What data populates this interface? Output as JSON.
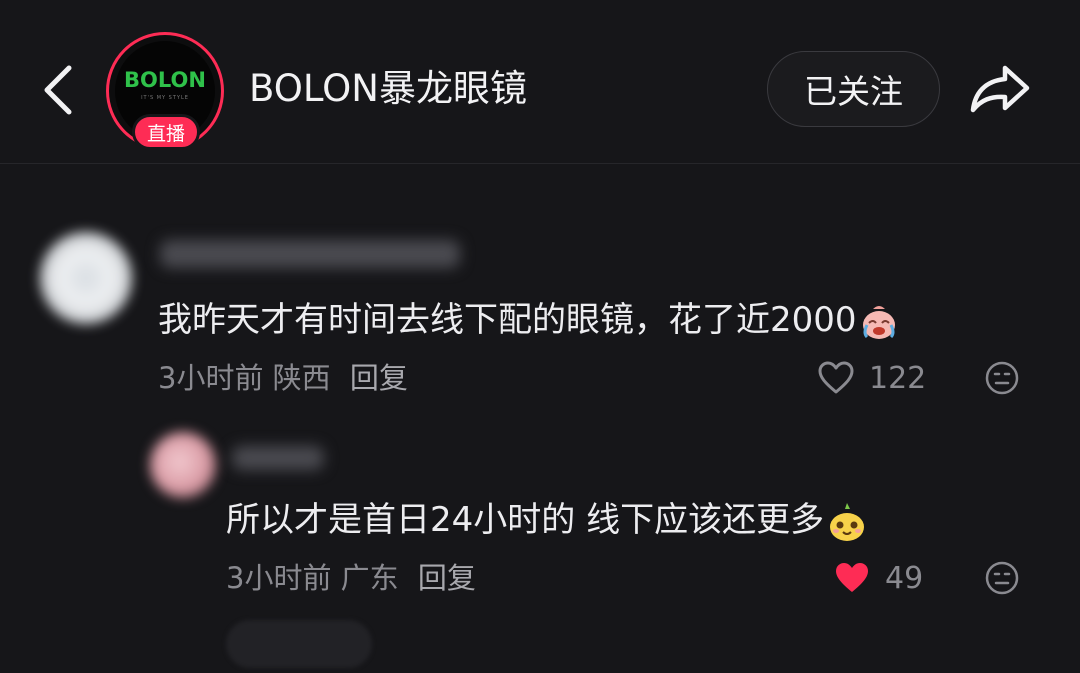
{
  "header": {
    "account_name": "BOLON暴龙眼镜",
    "avatar_logo": "BOLON",
    "avatar_tagline": "IT'S MY STYLE",
    "live_badge": "直播",
    "follow_label": "已关注",
    "back_icon": "chevron-left-icon",
    "share_icon": "share-arrow-icon"
  },
  "comments": [
    {
      "text": "我昨天才有时间去线下配的眼镜，花了近2000",
      "emoji": "crying-emoji",
      "time": "3小时前",
      "location": "陕西",
      "reply_label": "回复",
      "likes": "122",
      "liked": false
    },
    {
      "text": "所以才是首日24小时的 线下应该还更多",
      "emoji": "smug-emoji",
      "time": "3小时前",
      "location": "广东",
      "reply_label": "回复",
      "likes": "49",
      "liked": true
    }
  ],
  "colors": {
    "background": "#161619",
    "accent": "#fe2c55",
    "brand_green": "#2fc14a",
    "muted_text": "#8a8a90"
  }
}
